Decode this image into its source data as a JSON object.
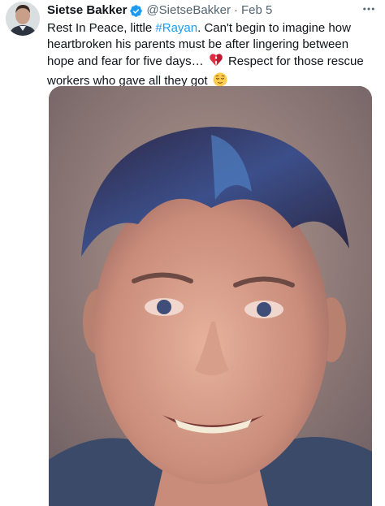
{
  "tweet": {
    "author_name": "Sietse Bakker",
    "author_handle": "@SietseBakker",
    "separator": "·",
    "date": "Feb 5",
    "text_part1": "Rest In Peace, little ",
    "hashtag": "#Rayan",
    "text_part2": ". Can't begin to imagine how heartbroken his parents must be after lingering between hope and fear for five days…",
    "text_part3": "Respect for those rescue workers who gave all they got",
    "icons": {
      "verified": "verified-badge-icon",
      "more": "more-options-icon",
      "broken_heart": "broken-heart-emoji",
      "relieved_face": "relieved-face-emoji"
    },
    "colors": {
      "link": "#1d9bf0",
      "verified": "#1d9bf0",
      "secondary_text": "#536471"
    }
  }
}
